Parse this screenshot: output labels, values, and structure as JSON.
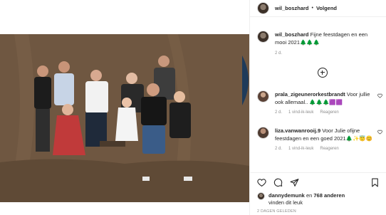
{
  "post": {
    "username": "wil_boszhard",
    "separator": "•",
    "follow_label": "Volgend"
  },
  "caption": {
    "username": "wil_boszhard",
    "text": "Fijne feestdagen en een mooi 2021🌲🌲🌲",
    "age": "2 d."
  },
  "comments": [
    {
      "username": "prala_zigeunerorkestbrandt",
      "text": "Voor jullie ook allemaal.. 🌲🌲🌲🟪🟪",
      "age": "2 d.",
      "likes": "1 vind-ik-leuk",
      "reply": "Reageren"
    },
    {
      "username": "liza.vanwanrooij.9",
      "text": "Voor Julie ofijne feestdagen en een goed 2021🌲✨😇😊",
      "age": "2 d.",
      "likes": "1 vind-ik-leuk",
      "reply": "Reageren"
    }
  ],
  "likes": {
    "user": "dannydemunk",
    "joiner": "en",
    "count": "768 anderen",
    "suffix": "vinden dit leuk"
  },
  "timestamp": "2 DAGEN GELEDEN",
  "icons": {
    "like": "heart-icon",
    "comment": "comment-icon",
    "share": "share-icon",
    "save": "bookmark-icon",
    "add_comment": "plus-circle-icon"
  },
  "colors": {
    "text": "#262626",
    "muted": "#8e8e8e",
    "border": "#efefef"
  }
}
